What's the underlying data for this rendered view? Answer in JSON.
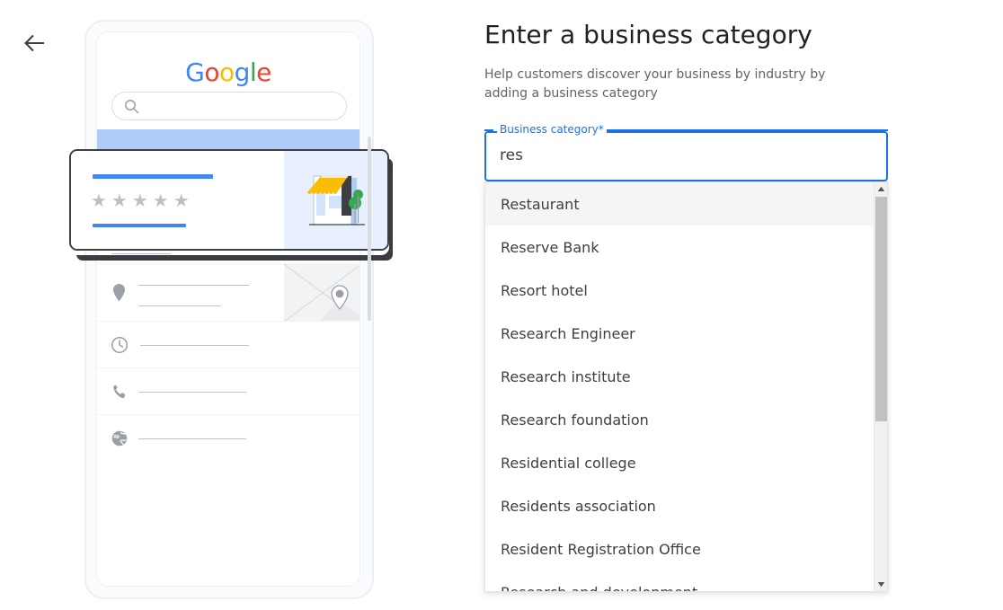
{
  "nav": {
    "back_icon": "arrow-left-icon",
    "back_label": "Back"
  },
  "panel": {
    "title": "Enter a business category",
    "subtitle": "Help customers discover your business by industry by adding a business category"
  },
  "field": {
    "label": "Business category*",
    "value": "res",
    "placeholder": "Business category",
    "accent_color": "#1a73e8"
  },
  "dropdown": {
    "selected_index": 0,
    "items": [
      {
        "label": "Restaurant"
      },
      {
        "label": "Reserve Bank"
      },
      {
        "label": "Resort hotel"
      },
      {
        "label": "Research Engineer"
      },
      {
        "label": "Research institute"
      },
      {
        "label": "Research foundation"
      },
      {
        "label": "Residential college"
      },
      {
        "label": "Residents association"
      },
      {
        "label": "Resident Registration Office"
      },
      {
        "label": "Research and development"
      }
    ],
    "scrollbar": {
      "up_icon": "caret-up-icon",
      "dn_icon": "caret-down-icon",
      "track_color": "#f1f1f1",
      "thumb_color": "#c1c1c1"
    }
  },
  "illustration": {
    "name": "google-business-profile-phone-mockup",
    "logo": {
      "name": "google-logo",
      "letters": [
        "G",
        "o",
        "o",
        "g",
        "l",
        "e"
      ],
      "colors": [
        "#4285F4",
        "#EA4335",
        "#FBBC05",
        "#4285F4",
        "#34A853",
        "#EA4335"
      ]
    },
    "search": {
      "icon": "search-icon"
    },
    "card": {
      "name": "business-listing-card",
      "rating_stars": "★★★★★",
      "star_count": 5,
      "storefront_icon": "storefront-illustration",
      "accent_color": "#4285F4",
      "panel_color": "#e8f0fe"
    },
    "action_icons": [
      {
        "name": "directions-icon"
      },
      {
        "name": "call-icon"
      },
      {
        "name": "save-bookmark-icon"
      },
      {
        "name": "share-icon"
      }
    ],
    "rows": [
      {
        "name": "description-row",
        "icon": "chevron-right-icon"
      },
      {
        "name": "address-row",
        "icon": "location-pin-icon",
        "thumb": "map-thumbnail"
      },
      {
        "name": "hours-row",
        "icon": "clock-icon"
      },
      {
        "name": "phone-row",
        "icon": "phone-icon"
      },
      {
        "name": "website-row",
        "icon": "globe-icon"
      }
    ]
  }
}
